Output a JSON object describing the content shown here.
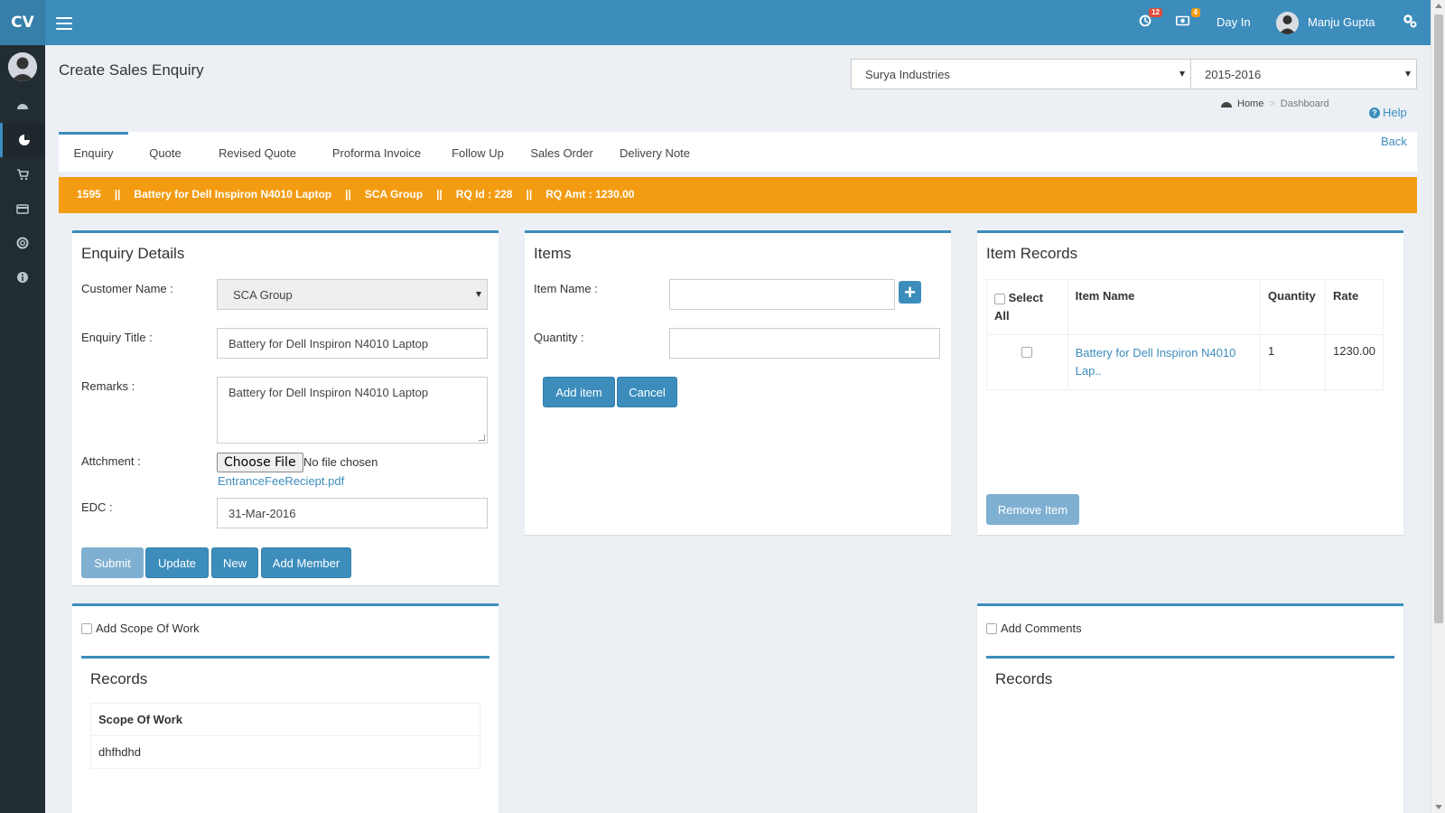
{
  "header": {
    "logo": "CV",
    "notifications_count": "12",
    "messages_count": "4",
    "day_in": "Day In",
    "user_name": "Manju Gupta"
  },
  "page": {
    "title": "Create Sales Enquiry",
    "company": "Surya Industries",
    "year": "2015-2016",
    "breadcrumb_home": "Home",
    "breadcrumb_current": "Dashboard",
    "help": "Help",
    "back": "Back"
  },
  "tabs": [
    {
      "label": "Enquiry"
    },
    {
      "label": "Quote"
    },
    {
      "label": "Revised Quote"
    },
    {
      "label": "Proforma Invoice"
    },
    {
      "label": "Follow Up"
    },
    {
      "label": "Sales Order"
    },
    {
      "label": "Delivery Note"
    }
  ],
  "banner": {
    "id": "1595",
    "title": "Battery for Dell Inspiron N4010 Laptop",
    "customer": "SCA Group",
    "rq_id": "RQ Id : 228",
    "rq_amt": "RQ Amt : 1230.00",
    "separator": "||"
  },
  "enquiry": {
    "title": "Enquiry Details",
    "customer_label": "Customer Name :",
    "customer_value": "SCA Group",
    "enquiry_title_label": "Enquiry Title :",
    "enquiry_title_value": "Battery for Dell Inspiron N4010 Laptop",
    "remarks_label": "Remarks :",
    "remarks_value": "Battery for Dell Inspiron N4010 Laptop",
    "attachment_label": "Attchment :",
    "choose_file": "Choose File",
    "no_file": "No file chosen",
    "attachment_link": "EntranceFeeReciept.pdf",
    "edc_label": "EDC :",
    "edc_value": "31-Mar-2016",
    "buttons": {
      "submit": "Submit",
      "update": "Update",
      "new": "New",
      "add_member": "Add Member"
    }
  },
  "items": {
    "title": "Items",
    "item_name_label": "Item Name :",
    "item_name_value": "",
    "quantity_label": "Quantity :",
    "quantity_value": "",
    "add_item": "Add item",
    "cancel": "Cancel"
  },
  "item_records": {
    "title": "Item Records",
    "col_select_1": "Select",
    "col_select_2": "All",
    "col_item_name": "Item Name",
    "col_quantity": "Quantity",
    "col_rate": "Rate",
    "rows": [
      {
        "item_name_1": "Battery for Dell Inspiron N4010",
        "item_name_2": "Lap..",
        "quantity": "1",
        "rate": "1230.00"
      }
    ],
    "remove_item": "Remove Item"
  },
  "scope": {
    "checkbox_label": "Add Scope Of Work",
    "records_title": "Records",
    "col_scope": "Scope Of Work",
    "rows": [
      {
        "scope": "dhfhdhd"
      }
    ]
  },
  "comments": {
    "checkbox_label": "Add Comments",
    "records_title": "Records"
  },
  "colors": {
    "primary": "#3c8dbc",
    "banner": "#f39c12",
    "sidebar": "#222d32"
  }
}
